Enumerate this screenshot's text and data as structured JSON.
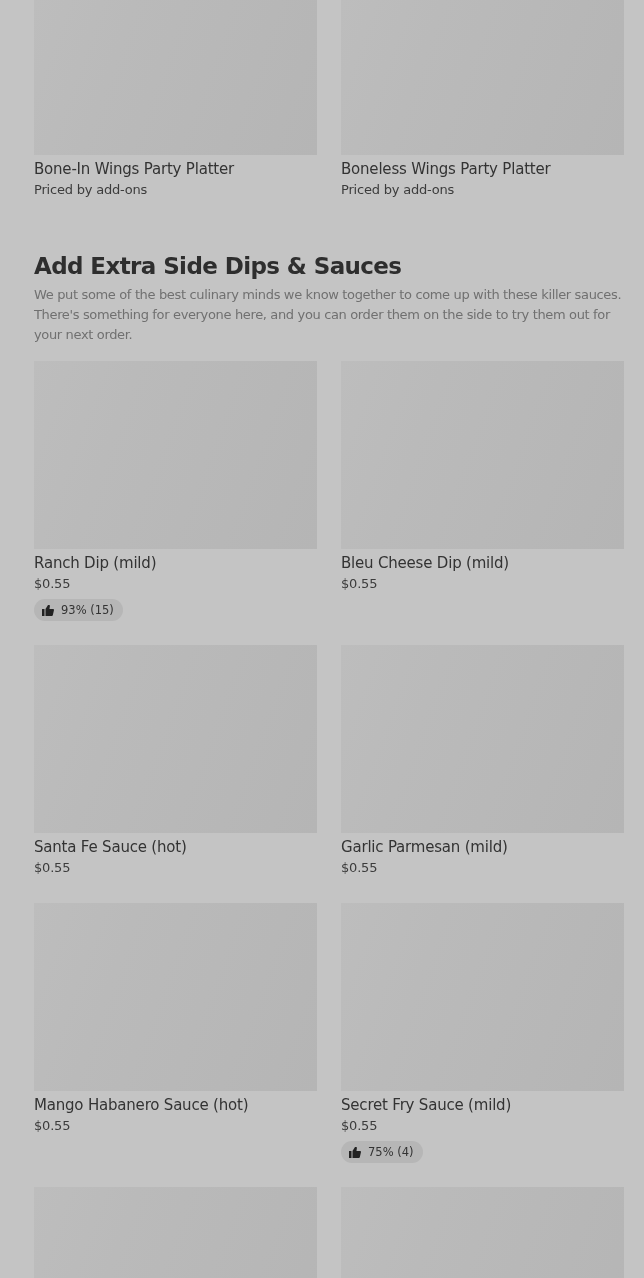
{
  "top_items": [
    {
      "name": "Bone-In Wings Party Platter",
      "price": "Priced by add-ons"
    },
    {
      "name": "Boneless Wings Party Platter",
      "price": "Priced by add-ons"
    }
  ],
  "section": {
    "title": "Add Extra Side Dips & Sauces",
    "description": "We put some of the best culinary minds we know together to come up with these killer sauces. There's something for everyone here, and you can order them on the side to try them out for your next order.",
    "items": [
      {
        "kind": "dish",
        "name": "Ranch Dip (mild)",
        "price": "$0.55",
        "rating": "93% (15)"
      },
      {
        "kind": "dish",
        "name": "Bleu Cheese Dip (mild)",
        "price": "$0.55"
      },
      {
        "kind": "dish",
        "name": "Santa Fe Sauce (hot)",
        "price": "$0.55"
      },
      {
        "kind": "dish",
        "name": "Garlic Parmesan (mild)",
        "price": "$0.55"
      },
      {
        "kind": "dish",
        "name": "Mango Habanero Sauce (hot)",
        "price": "$0.55"
      },
      {
        "kind": "dish",
        "name": "Secret Fry Sauce (mild)",
        "price": "$0.55",
        "rating": "75% (4)"
      },
      {
        "kind": "picture"
      },
      {
        "kind": "picture"
      }
    ]
  }
}
